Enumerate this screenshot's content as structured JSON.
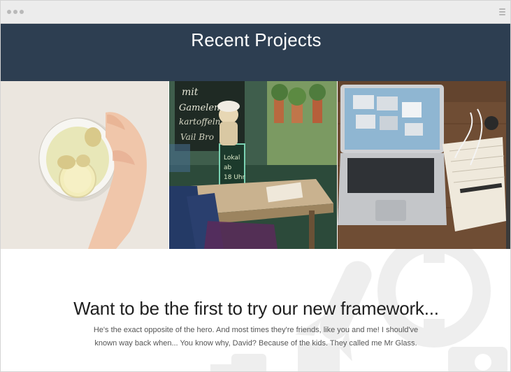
{
  "browser": {
    "window_dots": 3,
    "menu_icon": "hamburger-icon"
  },
  "projects": {
    "title": "Recent Projects",
    "band_color": "#2d3e51",
    "tiles": [
      {
        "subject": "ginger tea cup held by hand"
      },
      {
        "subject": "cafe table with chef figurine and chalkboard"
      },
      {
        "subject": "laptop, notebook and earphones on wooden desk"
      }
    ]
  },
  "cta": {
    "heading": "Want to be the first to try our new framework...",
    "body": "He's the exact opposite of the hero. And most times they're friends, like you and me! I should've known way back when... You know why, David? Because of the kids. They called me Mr Glass.",
    "background_icons": [
      "rocket-icon",
      "lifebuoy-icon",
      "camera-icon"
    ]
  }
}
